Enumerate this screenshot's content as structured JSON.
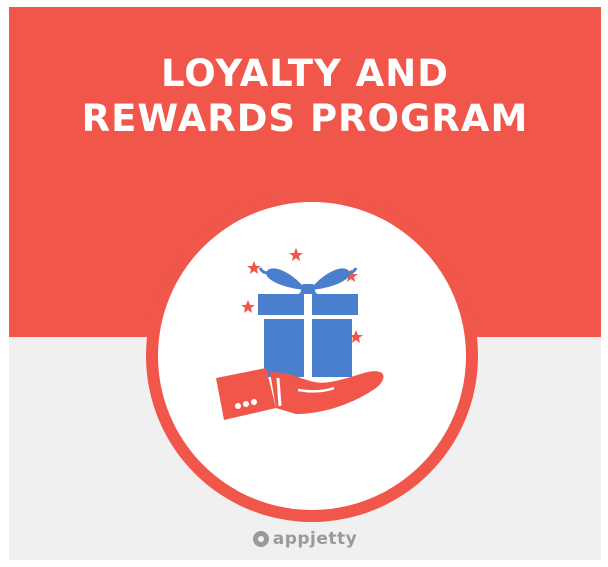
{
  "title": {
    "line1": "LOYALTY AND",
    "line2": "REWARDS PROGRAM"
  },
  "logo": {
    "text": "appjetty",
    "icon": "appjetty-logo-icon"
  },
  "illustration": {
    "icons": [
      "gift-box-icon",
      "hand-icon",
      "star-icon"
    ]
  },
  "colors": {
    "accent": "#f0564a",
    "gift": "#4a7fce",
    "background": "#f0f0f0",
    "logo": "#9a9a9a"
  }
}
